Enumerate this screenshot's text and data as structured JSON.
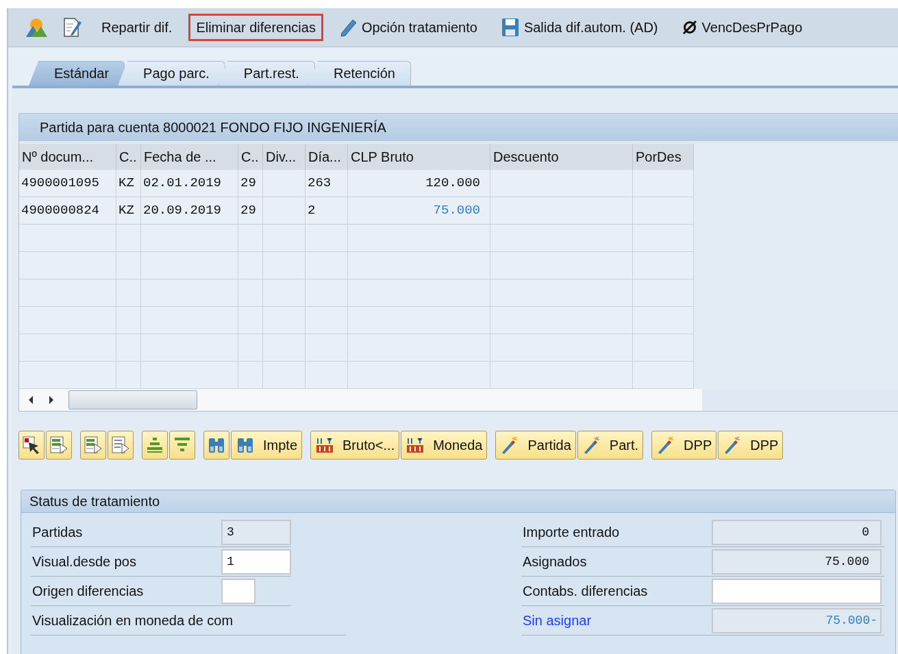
{
  "toolbar": [
    {
      "kind": "landscape",
      "highlighted": false
    },
    {
      "kind": "edit-doc",
      "highlighted": false
    },
    {
      "label": "Repartir dif.",
      "highlighted": false
    },
    {
      "label": "Eliminar diferencias",
      "highlighted": true
    },
    {
      "kind": "pencil",
      "label": "Opción tratamiento",
      "highlighted": false
    },
    {
      "kind": "save",
      "label": "Salida dif.autom. (AD)",
      "highlighted": false
    },
    {
      "kind": "no-symbol",
      "label": "VencDesPrPago",
      "highlighted": false
    }
  ],
  "tabs": [
    {
      "label": "Estándar",
      "selected": true
    },
    {
      "label": "Pago parc.",
      "selected": false
    },
    {
      "label": "Part.rest.",
      "selected": false
    },
    {
      "label": "Retención",
      "selected": false
    }
  ],
  "table": {
    "title": "Partida para cuenta 8000021 FONDO FIJO INGENIERÍA",
    "columns": [
      "Nº docum...",
      "C..",
      "Fecha de ...",
      "C..",
      "Div...",
      "Día...",
      "CLP Bruto",
      "Descuento",
      "PorDes"
    ],
    "rows": [
      {
        "cells": [
          "4900001095",
          "KZ",
          "02.01.2019",
          "29",
          null,
          "263",
          "120.000",
          null,
          null
        ],
        "assigned": false
      },
      {
        "cells": [
          "4900000824",
          "KZ",
          "20.09.2019",
          "29",
          null,
          "2",
          "75.000",
          null,
          null
        ],
        "assigned": true
      }
    ]
  },
  "button_groups": [
    {
      "buttons": [
        {
          "kind": "select-cursor"
        },
        {
          "kind": "doc-green"
        }
      ]
    },
    {
      "buttons": [
        {
          "kind": "doc-green-arrow"
        },
        {
          "kind": "doc-grey"
        }
      ]
    },
    {
      "buttons": [
        {
          "kind": "sort-up"
        },
        {
          "kind": "filter"
        }
      ]
    },
    {
      "buttons": [
        {
          "kind": "binoculars"
        },
        {
          "kind": "binoculars",
          "label": "Impte"
        }
      ]
    },
    {
      "buttons": [
        {
          "kind": "currency",
          "label": "Bruto<..."
        },
        {
          "kind": "currency",
          "label": "Moneda"
        }
      ]
    },
    {
      "buttons": [
        {
          "kind": "wand-spark",
          "label": "Partida"
        },
        {
          "kind": "wand",
          "label": "Part."
        }
      ]
    },
    {
      "buttons": [
        {
          "kind": "wand-spark",
          "label": "DPP"
        },
        {
          "kind": "wand",
          "label": "DPP"
        }
      ]
    }
  ],
  "status": {
    "title": "Status de tratamiento",
    "left": [
      {
        "label": "Partidas",
        "value": "3",
        "kind": "readonly"
      },
      {
        "label": "Visual.desde pos",
        "value": "1",
        "kind": "input"
      },
      {
        "label": "Origen diferencias",
        "kind": "short-input"
      },
      {
        "label": "Visualización en moneda de com",
        "kind": "text"
      }
    ],
    "right": [
      {
        "label": "Importe entrado",
        "value": "0",
        "kind": "readonly",
        "link": false
      },
      {
        "label": "Asignados",
        "value": "75.000",
        "kind": "readonly",
        "link": false
      },
      {
        "label": "Contabs. diferencias",
        "kind": "input",
        "link": false
      },
      {
        "label": "Sin asignar",
        "value": "75.000-",
        "kind": "readonly",
        "link": true
      }
    ]
  }
}
